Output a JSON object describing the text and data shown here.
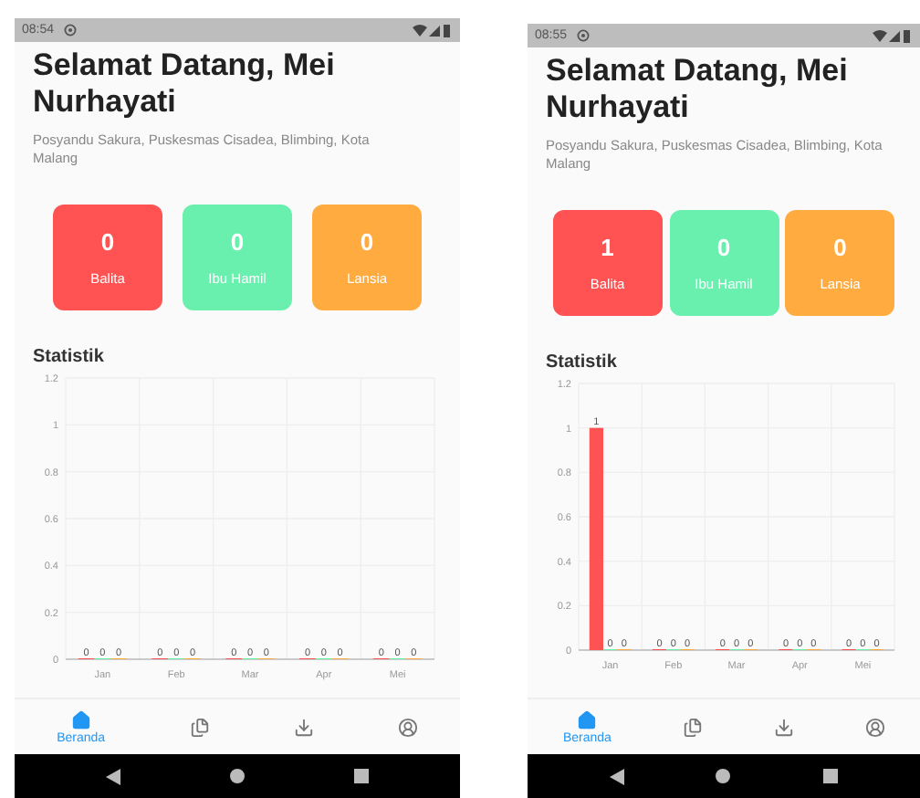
{
  "screens": [
    {
      "status_bar": {
        "time": "08:54"
      },
      "greeting": "Selamat Datang, Mei Nurhayati",
      "location": "Posyandu Sakura, Puskesmas Cisadea, Blimbing, Kota Malang",
      "stats": [
        {
          "value": "0",
          "label": "Balita",
          "color": "#ff5252"
        },
        {
          "value": "0",
          "label": "Ibu Hamil",
          "color": "#69f0ae"
        },
        {
          "value": "0",
          "label": "Lansia",
          "color": "#ffab40"
        }
      ],
      "statistics": {
        "title": "Statistik",
        "chart_data": {
          "type": "bar",
          "categories": [
            "Jan",
            "Feb",
            "Mar",
            "Apr",
            "Mei"
          ],
          "series": [
            {
              "color": "#ff5252",
              "values": [
                0,
                0,
                0,
                0,
                0
              ]
            },
            {
              "color": "#69f0ae",
              "values": [
                0,
                0,
                0,
                0,
                0
              ]
            },
            {
              "color": "#ffab40",
              "values": [
                0,
                0,
                0,
                0,
                0
              ]
            }
          ],
          "ylim": [
            0,
            1.2
          ],
          "yticks": [
            0,
            0.2,
            0.4,
            0.6,
            0.8,
            1,
            1.2
          ],
          "grid": true,
          "data_labels": true
        }
      },
      "nav": [
        {
          "kind": "home",
          "label": "Beranda",
          "selected": true
        },
        {
          "kind": "files",
          "selected": false
        },
        {
          "kind": "download",
          "selected": false
        },
        {
          "kind": "account",
          "selected": false
        }
      ]
    },
    {
      "status_bar": {
        "time": "08:55"
      },
      "greeting": "Selamat Datang, Mei Nurhayati",
      "location": "Posyandu Sakura, Puskesmas Cisadea, Blimbing, Kota Malang",
      "stats": [
        {
          "value": "1",
          "label": "Balita",
          "color": "#ff5252"
        },
        {
          "value": "0",
          "label": "Ibu Hamil",
          "color": "#69f0ae"
        },
        {
          "value": "0",
          "label": "Lansia",
          "color": "#ffab40"
        }
      ],
      "statistics": {
        "title": "Statistik",
        "chart_data": {
          "type": "bar",
          "categories": [
            "Jan",
            "Feb",
            "Mar",
            "Apr",
            "Mei"
          ],
          "series": [
            {
              "color": "#ff5252",
              "values": [
                1,
                0,
                0,
                0,
                0
              ]
            },
            {
              "color": "#69f0ae",
              "values": [
                0,
                0,
                0,
                0,
                0
              ]
            },
            {
              "color": "#ffab40",
              "values": [
                0,
                0,
                0,
                0,
                0
              ]
            }
          ],
          "ylim": [
            0,
            1.2
          ],
          "yticks": [
            0,
            0.2,
            0.4,
            0.6,
            0.8,
            1,
            1.2
          ],
          "grid": true,
          "data_labels": true
        }
      },
      "nav": [
        {
          "kind": "home",
          "label": "Beranda",
          "selected": true
        },
        {
          "kind": "files",
          "selected": false
        },
        {
          "kind": "download",
          "selected": false
        },
        {
          "kind": "account",
          "selected": false
        }
      ]
    }
  ]
}
